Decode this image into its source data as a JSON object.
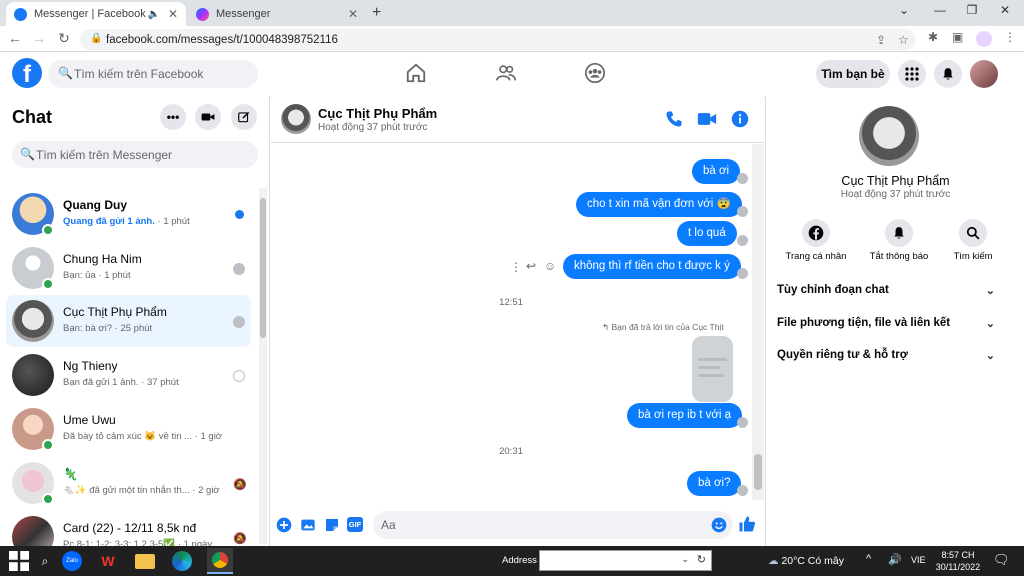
{
  "browser": {
    "tabs": [
      {
        "title": "Messenger | Facebook",
        "active": true
      },
      {
        "title": "Messenger",
        "active": false
      }
    ],
    "url": "facebook.com/messages/t/100048398752116"
  },
  "fb_header": {
    "search_placeholder": "Tìm kiếm trên Facebook",
    "find_friends": "Tìm bạn bè",
    "brand_color": "#1877f2"
  },
  "chat_list": {
    "title": "Chat",
    "search_placeholder": "Tìm kiếm trên Messenger",
    "items": [
      {
        "name": "Quang Duy",
        "preview": "Quang đã gửi 1 ảnh.",
        "time": "· 1 phút",
        "unread": true,
        "online": true
      },
      {
        "name": "Chung Ha Nim",
        "preview": "Bạn: ủa",
        "time": "· 1 phút",
        "unread": false,
        "online": true
      },
      {
        "name": "Cục Thịt Phụ Phẩm",
        "preview": "Bạn: bà ơi?",
        "time": "· 25 phút",
        "unread": false,
        "online": false,
        "selected": true
      },
      {
        "name": "Ng Thieny",
        "preview": "Bạn đã gửi 1 ảnh.",
        "time": "· 37 phút",
        "unread": false,
        "online": false
      },
      {
        "name": "Ume Uwu",
        "preview": "Đã bày tỏ cảm xúc 😺 về tin ...",
        "time": "· 1 giờ",
        "unread": false,
        "online": true
      },
      {
        "name": "🦎",
        "preview": "🐁✨ đã gửi một tin nhắn th...",
        "time": "· 2 giờ",
        "unread": false,
        "online": true
      },
      {
        "name": "Card (22) - 12/11 8,5k nđ",
        "preview": "Pc 8-1; 1-2; 3-3; 1,2,3-5✅",
        "time": "· 1 ngày",
        "unread": false,
        "online": false
      }
    ]
  },
  "conversation": {
    "name": "Cục Thịt Phụ Phẩm",
    "status": "Hoạt động 37 phút trước",
    "messages": [
      {
        "text": "bà ơi"
      },
      {
        "text": "cho t xin mã vận đơn với 😨"
      },
      {
        "text": "t lo quá"
      },
      {
        "text": "không thì rf tiền cho t được k ý"
      },
      {
        "time": "12:51"
      },
      {
        "reply_note": "↰ Bạn đã trả lời tin của Cục Thịt"
      },
      {
        "text": "bà ơi rep ib t với ạ"
      },
      {
        "time": "20:31"
      },
      {
        "text": "bà ơi?"
      }
    ],
    "composer_placeholder": "Aa"
  },
  "info_panel": {
    "name": "Cục Thịt Phụ Phẩm",
    "status": "Hoạt động 37 phút trước",
    "actions": [
      "Trang cá nhân",
      "Tắt thông báo",
      "Tìm kiếm"
    ],
    "sections": [
      "Tùy chỉnh đoạn chat",
      "File phương tiện, file và liên kết",
      "Quyền riêng tư & hỗ trợ"
    ]
  },
  "taskbar": {
    "address_label": "Address",
    "weather": "20°C  Có mây",
    "lang": "VIE",
    "time": "8:57 CH",
    "date": "30/11/2022"
  }
}
